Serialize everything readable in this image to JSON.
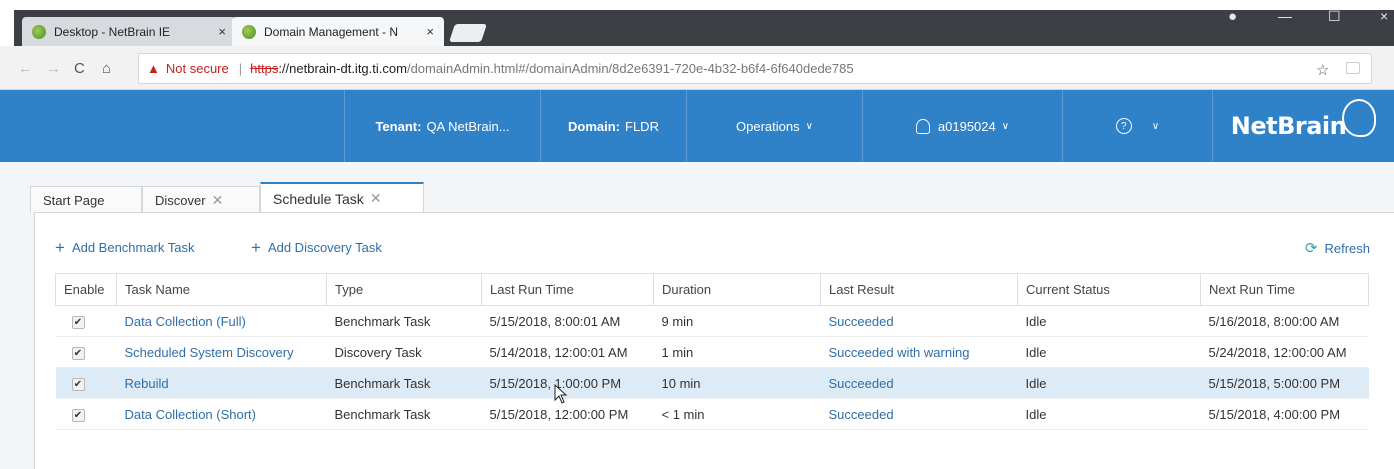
{
  "browser": {
    "tabs": [
      {
        "title": "Desktop - NetBrain IE"
      },
      {
        "title": "Domain Management - N"
      }
    ],
    "address": {
      "warning": "Not secure",
      "scheme": "https",
      "host": "://netbrain-dt.itg.ti.com",
      "path": "/domainAdmin.html#/domainAdmin/8d2e6391-720e-4b32-b6f4-6f640dede785"
    }
  },
  "header": {
    "tenant_label": "Tenant:",
    "tenant_value": "QA NetBrain...",
    "domain_label": "Domain:",
    "domain_value": "FLDR",
    "operations": "Operations",
    "user": "a0195024",
    "logo": "NetBrain"
  },
  "page_tabs": [
    {
      "label": "Start Page"
    },
    {
      "label": "Discover"
    },
    {
      "label": "Schedule Task"
    }
  ],
  "toolbar": {
    "add_benchmark": "Add Benchmark Task",
    "add_discovery": "Add Discovery Task",
    "refresh": "Refresh"
  },
  "table": {
    "columns": [
      "Enable",
      "Task Name",
      "Type",
      "Last Run Time",
      "Duration",
      "Last Result",
      "Current Status",
      "Next Run Time"
    ],
    "rows": [
      {
        "enabled": true,
        "name": "Data Collection (Full)",
        "type": "Benchmark Task",
        "last_run": "5/15/2018, 8:00:01 AM",
        "duration": "9 min",
        "result": "Succeeded",
        "status": "Idle",
        "next_run": "5/16/2018, 8:00:00 AM",
        "selected": false
      },
      {
        "enabled": true,
        "name": "Scheduled System Discovery",
        "type": "Discovery Task",
        "last_run": "5/14/2018, 12:00:01 AM",
        "duration": "1 min",
        "result": "Succeeded with warning",
        "status": "Idle",
        "next_run": "5/24/2018, 12:00:00 AM",
        "selected": false
      },
      {
        "enabled": true,
        "name": "Rebuild",
        "type": "Benchmark Task",
        "last_run": "5/15/2018, 1:00:00 PM",
        "duration": "10 min",
        "result": "Succeeded",
        "status": "Idle",
        "next_run": "5/15/2018, 5:00:00 PM",
        "selected": true
      },
      {
        "enabled": true,
        "name": "Data Collection (Short)",
        "type": "Benchmark Task",
        "last_run": "5/15/2018, 12:00:00 PM",
        "duration": "< 1 min",
        "result": "Succeeded",
        "status": "Idle",
        "next_run": "5/15/2018, 4:00:00 PM",
        "selected": false
      }
    ]
  },
  "colors": {
    "header_blue": "#2f82c8",
    "link_blue": "#2f6ea9",
    "selected_row": "#ddebf7"
  }
}
